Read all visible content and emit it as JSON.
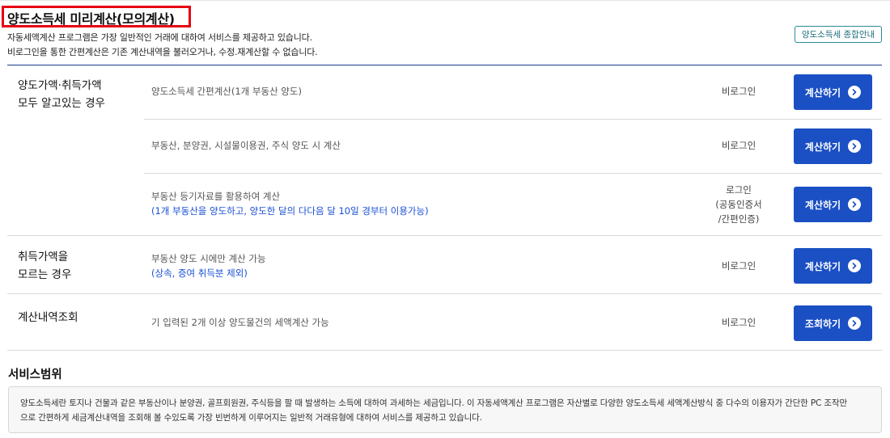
{
  "header": {
    "title": "양도소득세 미리계산(모의계산)",
    "intro_line1": "자동세액계산 프로그램은 가장 일반적인 거래에 대하여 서비스를 제공하고 있습니다.",
    "intro_line2": "비로그인을 통한 간편계산은 기존 계산내역을 불러오거나, 수정.재계산할 수 없습니다.",
    "guide_button": "양도소득세 종합안내"
  },
  "sections": [
    {
      "category_line1": "양도가액·취득가액",
      "category_line2": "모두 알고있는 경우",
      "rows": [
        {
          "desc": "양도소득세 간편계산(1개 부동산 양도)",
          "login": "비로그인",
          "button": "계산하기"
        },
        {
          "desc": "부동산, 분양권, 시설물이용권, 주식 양도 시 계산",
          "login": "비로그인",
          "button": "계산하기"
        },
        {
          "desc": "부동산 등기자료를 활용하여 계산",
          "note": "(1개 부동산을 양도하고, 양도한 달의 다다음 달 10일 경부터 이용가능)",
          "login_line1": "로그인",
          "login_line2": "(공동인증서",
          "login_line3": "/간편인증)",
          "button": "계산하기"
        }
      ]
    },
    {
      "category_line1": "취득가액을",
      "category_line2": "모르는 경우",
      "rows": [
        {
          "desc": "부동산 양도 시에만 계산 가능",
          "note": "(상속, 증여 취득분 제외)",
          "login": "비로그인",
          "button": "계산하기"
        }
      ]
    },
    {
      "category_line1": "계산내역조회",
      "rows": [
        {
          "desc": "기 입력된 2개 이상 양도물건의 세액계산 가능",
          "login": "비로그인",
          "button": "조회하기"
        }
      ]
    }
  ],
  "service_scope": {
    "title": "서비스범위",
    "text_line1": "양도소득세란 토지나 건물과 같은 부동산이나 분양권, 골프회원권, 주식등을 팔 때 발생하는 소득에 대하여 과세하는 세금입니다. 이 자동세액계산 프로그램은 자산별로 다양한 양도소득세 세액계산방식 중 다수의 이용자가 간단한 PC 조작만",
    "text_line2": "으로 간편하게 세금계산내역을 조회해 볼 수있도록 가장 빈번하게 이루어지는 일반적 거래유형에 대하여 서비스를 제공하고 있습니다."
  },
  "icons": {
    "button_arrow": "chevron-right-circle-icon"
  },
  "colors": {
    "primary_button": "#1b4fc4",
    "highlight_border": "#e60012",
    "note_text": "#1a4fd6",
    "guide_border": "#2b8a9a"
  }
}
